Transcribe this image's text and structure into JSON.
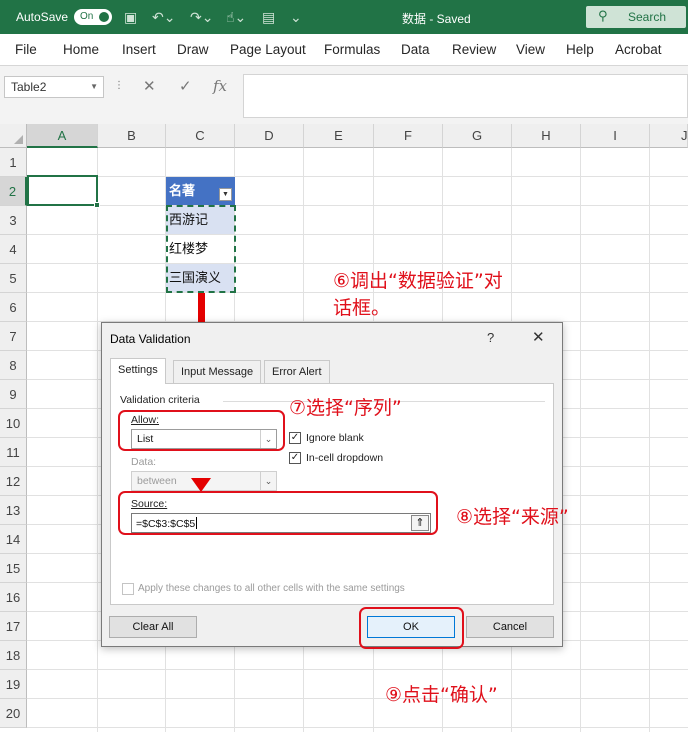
{
  "titlebar": {
    "autosave_label": "AutoSave",
    "autosave_state": "On",
    "document_title": "数据 - Saved",
    "search_label": "Search"
  },
  "ribbon": {
    "tabs": [
      "File",
      "Home",
      "Insert",
      "Draw",
      "Page Layout",
      "Formulas",
      "Data",
      "Review",
      "View",
      "Help",
      "Acrobat"
    ]
  },
  "formula_bar": {
    "name_box": "Table2",
    "fx_label": "fx",
    "value": ""
  },
  "grid": {
    "columns": [
      "A",
      "B",
      "C",
      "D",
      "E",
      "F",
      "G",
      "H",
      "I",
      "J"
    ],
    "rows": [
      "1",
      "2",
      "3",
      "4",
      "5",
      "6",
      "7",
      "8",
      "9",
      "10",
      "11",
      "12",
      "13",
      "14",
      "15",
      "16",
      "17",
      "18",
      "19",
      "20"
    ],
    "table_header": "名著",
    "table_values": [
      "西游记",
      "红楼梦",
      "三国演义"
    ]
  },
  "dialog": {
    "title": "Data Validation",
    "help": "?",
    "close": "✕",
    "tabs": [
      "Settings",
      "Input Message",
      "Error Alert"
    ],
    "group_label": "Validation criteria",
    "allow_label": "Allow:",
    "allow_value": "List",
    "ignore_blank_label": "Ignore blank",
    "ignore_blank_checked": true,
    "incell_dropdown_label": "In-cell dropdown",
    "incell_dropdown_checked": true,
    "data_label": "Data:",
    "data_value": "between",
    "source_label": "Source:",
    "source_value": "=$C$3:$C$5",
    "apply_all_label": "Apply these changes to all other cells with the same settings",
    "clear_all_label": "Clear All",
    "ok_label": "OK",
    "cancel_label": "Cancel"
  },
  "annotations": {
    "step6_line1": "⑥调出“数据验证”对",
    "step6_line2": "话框。",
    "step7": "⑦选择“序列”",
    "step8": "⑧选择“来源”",
    "step9": "⑨点击“确认”",
    "color": "#e0101b"
  },
  "colors": {
    "excel_green": "#217346",
    "table_header_blue": "#4472c4",
    "table_band": "#d9e1f2"
  }
}
